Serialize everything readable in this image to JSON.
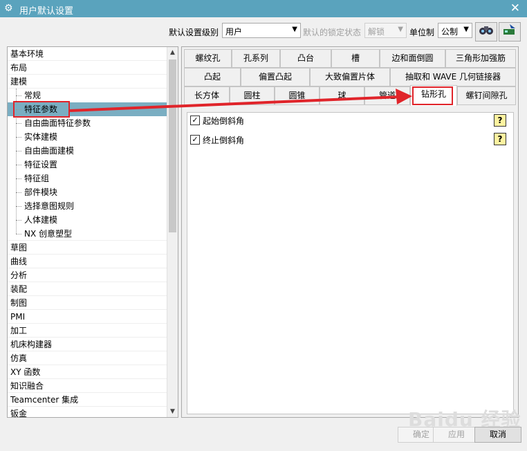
{
  "window": {
    "title": "用户默认设置",
    "close_glyph": "✕"
  },
  "topbar": {
    "level_label": "默认设置级别",
    "level_value": "用户",
    "lock_label": "默认的锁定状态",
    "lock_value": "解锁",
    "unit_label": "单位制",
    "unit_value": "公制"
  },
  "tree": {
    "items": [
      {
        "label": "基本环境"
      },
      {
        "label": "布局"
      },
      {
        "label": "建模"
      },
      {
        "label": "常规"
      },
      {
        "label": "特征参数"
      },
      {
        "label": "自由曲面特征参数"
      },
      {
        "label": "实体建模"
      },
      {
        "label": "自由曲面建模"
      },
      {
        "label": "特征设置"
      },
      {
        "label": "特征组"
      },
      {
        "label": "部件模块"
      },
      {
        "label": "选择意图规则"
      },
      {
        "label": "人体建模"
      },
      {
        "label": "NX 创意塑型"
      },
      {
        "label": "草图"
      },
      {
        "label": "曲线"
      },
      {
        "label": "分析"
      },
      {
        "label": "装配"
      },
      {
        "label": "制图"
      },
      {
        "label": "PMI"
      },
      {
        "label": "加工"
      },
      {
        "label": "机床构建器"
      },
      {
        "label": "仿真"
      },
      {
        "label": "XY 函数"
      },
      {
        "label": "知识融合"
      },
      {
        "label": "Teamcenter 集成"
      },
      {
        "label": "钣金"
      }
    ]
  },
  "tabs": {
    "row1": [
      "螺纹孔",
      "孔系列",
      "凸台",
      "槽",
      "边和面倒圆",
      "三角形加强筋"
    ],
    "row2": [
      "凸起",
      "偏置凸起",
      "大致偏置片体",
      "抽取和 WAVE 几何链接器"
    ],
    "row3": [
      "长方体",
      "圆柱",
      "圆锥",
      "球",
      "管道",
      "钻形孔",
      "螺钉间隙孔"
    ]
  },
  "options": [
    {
      "label": "起始倒斜角",
      "checked": true
    },
    {
      "label": "终止倒斜角",
      "checked": true
    }
  ],
  "help_glyph": "?",
  "buttons": {
    "ok": "确定",
    "apply": "应用",
    "cancel": "取消"
  },
  "watermark": "Baidu 经验"
}
